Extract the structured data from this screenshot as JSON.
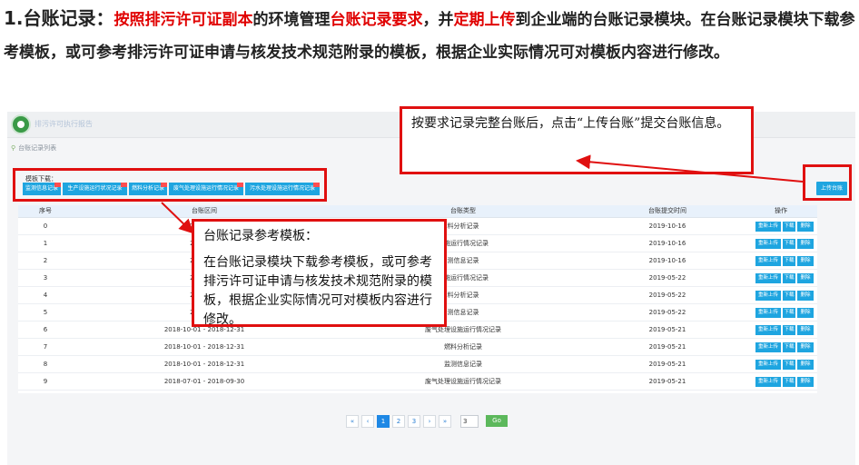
{
  "intro": {
    "number": "1.",
    "heading": "台账记录：",
    "red1": "按照排污许可证副本",
    "t1": "的环境管理",
    "red2": "台账记录要求",
    "t2": "，并",
    "red3": "定期上传",
    "t3": "到企业端的台账记录模块。在台账记录模块下载参考模板，或可参考排污许可证申请与核发技术规范附录的模板，根据企业实际情况可对模板内容进行修改。"
  },
  "app": {
    "system_title": "排污许可执行报告",
    "breadcrumb": "台账记录列表",
    "template_label": "模板下载：",
    "template_buttons": [
      "监测信息记录",
      "生产设施运行状况记录",
      "燃料分析记录",
      "废气处理设施运行情况记录",
      "污水处理设施运行情况记录"
    ],
    "upload_button": "上传台账"
  },
  "table": {
    "headers": [
      "序号",
      "台账区间",
      "台账类型",
      "台账提交时间",
      "操作"
    ],
    "actions": [
      "重新上传",
      "下载",
      "删除"
    ],
    "rows": [
      {
        "idx": "0",
        "period": "2019-07-",
        "type": "料分析记录",
        "time": "2019-10-16"
      },
      {
        "idx": "1",
        "period": "2019-07-",
        "type": "设施运行情况记录",
        "time": "2019-10-16"
      },
      {
        "idx": "2",
        "period": "2019-07-",
        "type": "测信息记录",
        "time": "2019-10-16"
      },
      {
        "idx": "3",
        "period": "2019-01-",
        "type": "设施运行情况记录",
        "time": "2019-05-22"
      },
      {
        "idx": "4",
        "period": "2019-01-",
        "type": "料分析记录",
        "time": "2019-05-22"
      },
      {
        "idx": "5",
        "period": "2019-01-",
        "type": "测信息记录",
        "time": "2019-05-22"
      },
      {
        "idx": "6",
        "period": "2018-10-01 - 2018-12-31",
        "type": "废气处理设施运行情况记录",
        "time": "2019-05-21"
      },
      {
        "idx": "7",
        "period": "2018-10-01 - 2018-12-31",
        "type": "燃料分析记录",
        "time": "2019-05-21"
      },
      {
        "idx": "8",
        "period": "2018-10-01 - 2018-12-31",
        "type": "监测信息记录",
        "time": "2019-05-21"
      },
      {
        "idx": "9",
        "period": "2018-07-01 - 2018-09-30",
        "type": "废气处理设施运行情况记录",
        "time": "2019-05-21"
      }
    ]
  },
  "pager": {
    "buttons": [
      "«",
      "‹",
      "1",
      "2",
      "3",
      "›",
      "»"
    ],
    "active": "1",
    "goto_value": "3",
    "go_label": "Go"
  },
  "callouts": {
    "upload": "按要求记录完整台账后，点击“上传台账”提交台账信息。",
    "template_title": "台账记录参考模板：",
    "template_body": "在台账记录模块下载参考模板，或可参考排污许可证申请与核发技术规范附录的模板，根据企业实际情况可对模板内容进行修改。"
  },
  "colors": {
    "accent_blue": "#1ea5e0",
    "annotation_red": "#e01010",
    "emphasis_red": "#e00000"
  }
}
